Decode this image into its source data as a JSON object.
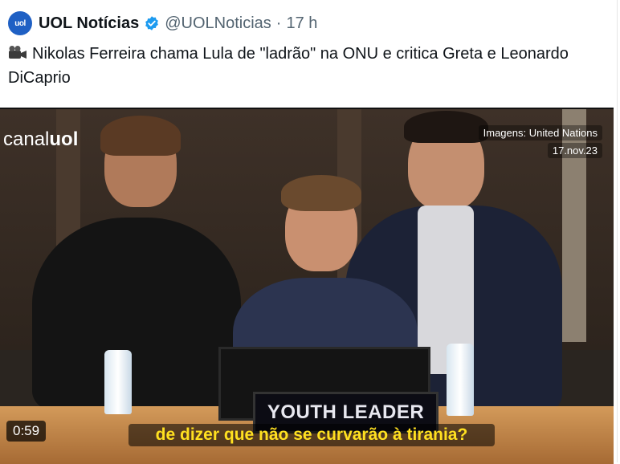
{
  "tweet": {
    "author_name": "UOL Notícias",
    "logo_text": "uol",
    "handle": "@UOLNoticias",
    "separator": "·",
    "time": "17 h",
    "text": "Nikolas Ferreira chama Lula de \"ladrão\" na ONU e critica Greta e Leonardo DiCaprio"
  },
  "video": {
    "watermark_prefix": "canal",
    "watermark_brand": "uol",
    "credit": "Imagens: United Nations",
    "date": "17.nov.23",
    "nameplate": "YOUTH LEADER",
    "subtitle": "de dizer que não se curvarão à tirania?",
    "duration": "0:59"
  },
  "colors": {
    "brand_blue": "#1f60c4",
    "subtitle_yellow": "#ffe020",
    "verified_blue": "#1d9bf0"
  }
}
